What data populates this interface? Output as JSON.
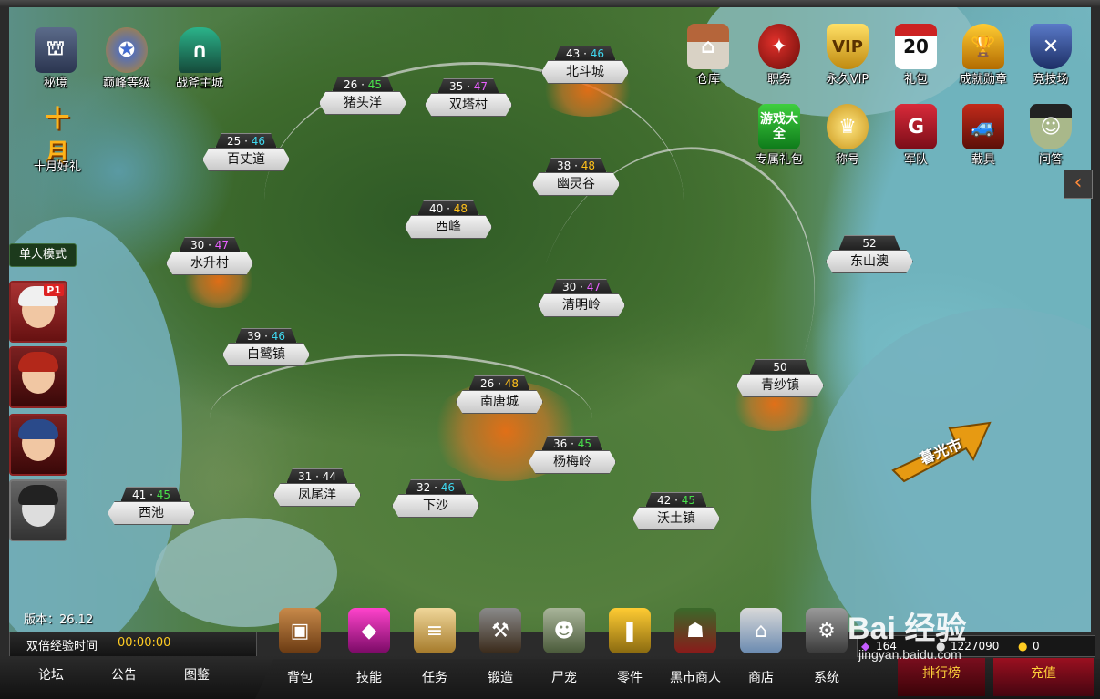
{
  "top_left": [
    {
      "label": "秘境",
      "icon": "tower-icon"
    },
    {
      "label": "巅峰等级",
      "icon": "winged-badge-icon"
    },
    {
      "label": "战斧主城",
      "icon": "castle-gate-icon"
    }
  ],
  "october": {
    "badge": "十月",
    "label": "十月好礼"
  },
  "top_right_row1": [
    {
      "label": "仓库",
      "icon": "warehouse-icon"
    },
    {
      "label": "职务",
      "icon": "beret-icon"
    },
    {
      "label": "永久VIP",
      "icon": "vip-shield-icon",
      "badge": "VIP"
    },
    {
      "label": "礼包",
      "icon": "calendar-icon",
      "badge": "20"
    },
    {
      "label": "成就勋章",
      "icon": "trophy-icon"
    },
    {
      "label": "竞技场",
      "icon": "crossed-guns-icon"
    }
  ],
  "top_right_row2": [
    {
      "label": "专属礼包",
      "icon": "game-center-icon",
      "badge": "游戏大全"
    },
    {
      "label": "称号",
      "icon": "crown-icon"
    },
    {
      "label": "军队",
      "icon": "army-banner-icon",
      "badge": "G"
    },
    {
      "label": "载具",
      "icon": "vehicle-icon"
    },
    {
      "label": "问答",
      "icon": "zombie-scholar-icon"
    }
  ],
  "single_mode": "单人模式",
  "player_badge": "P1",
  "locations": [
    {
      "name": "北斗城",
      "lv_min": "43",
      "lv_max": "46",
      "max_color": "cyan"
    },
    {
      "name": "猪头洋",
      "lv_min": "26",
      "lv_max": "45",
      "max_color": "green"
    },
    {
      "name": "双塔村",
      "lv_min": "35",
      "lv_max": "47",
      "max_color": "purple"
    },
    {
      "name": "百丈道",
      "lv_min": "25",
      "lv_max": "46",
      "max_color": "cyan"
    },
    {
      "name": "幽灵谷",
      "lv_min": "38",
      "lv_max": "48",
      "max_color": "orange"
    },
    {
      "name": "西峰",
      "lv_min": "40",
      "lv_max": "48",
      "max_color": "orange"
    },
    {
      "name": "水升村",
      "lv_min": "30",
      "lv_max": "47",
      "max_color": "purple"
    },
    {
      "name": "东山澳",
      "lv_min": "52",
      "lv_max": "",
      "max_color": ""
    },
    {
      "name": "清明岭",
      "lv_min": "30",
      "lv_max": "47",
      "max_color": "purple"
    },
    {
      "name": "白鹭镇",
      "lv_min": "39",
      "lv_max": "46",
      "max_color": "cyan"
    },
    {
      "name": "南唐城",
      "lv_min": "26",
      "lv_max": "48",
      "max_color": "orange"
    },
    {
      "name": "青纱镇",
      "lv_min": "50",
      "lv_max": "",
      "max_color": ""
    },
    {
      "name": "杨梅岭",
      "lv_min": "36",
      "lv_max": "45",
      "max_color": "green"
    },
    {
      "name": "凤尾洋",
      "lv_min": "31",
      "lv_max": "44",
      "max_color": "white"
    },
    {
      "name": "西池",
      "lv_min": "41",
      "lv_max": "45",
      "max_color": "green"
    },
    {
      "name": "下沙",
      "lv_min": "32",
      "lv_max": "46",
      "max_color": "cyan"
    },
    {
      "name": "沃土镇",
      "lv_min": "42",
      "lv_max": "45",
      "max_color": "green"
    }
  ],
  "go_arrow": "暮光市",
  "version": "版本：26.12",
  "double_exp": {
    "label": "双倍经验时间",
    "time": "00:00:00"
  },
  "bottom_left_nav": [
    "论坛",
    "公告",
    "图鉴"
  ],
  "menu": [
    {
      "label": "背包",
      "icon": "backpack-icon"
    },
    {
      "label": "技能",
      "icon": "skill-gem-icon"
    },
    {
      "label": "任务",
      "icon": "scroll-icon"
    },
    {
      "label": "锻造",
      "icon": "hammer-icon"
    },
    {
      "label": "尸宠",
      "icon": "zombie-pet-icon"
    },
    {
      "label": "零件",
      "icon": "bullets-icon"
    },
    {
      "label": "黑市商人",
      "icon": "hooded-merchant-icon"
    },
    {
      "label": "商店",
      "icon": "shop-icon"
    },
    {
      "label": "系统",
      "icon": "gear-icon"
    }
  ],
  "currency": {
    "gems": "164",
    "silver": "1227090",
    "gold": "0"
  },
  "rank_button": "排行榜",
  "recharge_button": "充值",
  "watermark": {
    "main": "Bai 经验",
    "sub": "jingyan.baidu.com"
  },
  "colors": {
    "green": "#48e04a",
    "cyan": "#3fd8f0",
    "purple": "#e860ff",
    "orange": "#ffc11a",
    "white": "#ffffff",
    "accent": "#ff8a3a"
  }
}
